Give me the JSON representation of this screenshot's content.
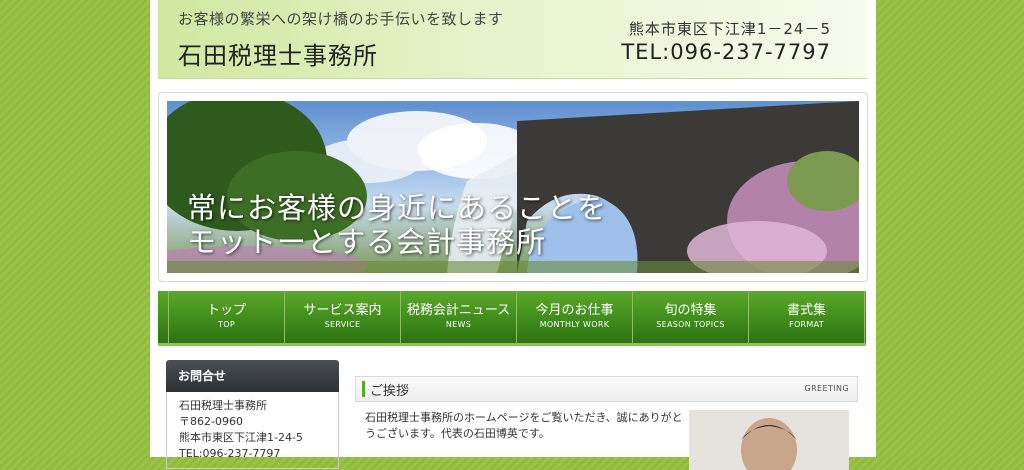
{
  "header": {
    "tagline": "お客様の繁栄への架け橋のお手伝いを致します",
    "firm_name": "石田税理士事務所",
    "address": "熊本市東区下江津1－24－5",
    "tel": "TEL:096-237-7797"
  },
  "hero": {
    "line1": "常にお客様の身近にあることを",
    "line2": "モットーとする会計事務所"
  },
  "nav": [
    {
      "jp": "トップ",
      "en": "TOP"
    },
    {
      "jp": "サービス案内",
      "en": "SERVICE"
    },
    {
      "jp": "税務会計ニュース",
      "en": "NEWS"
    },
    {
      "jp": "今月のお仕事",
      "en": "MONTHLY WORK"
    },
    {
      "jp": "旬の特集",
      "en": "SEASON TOPICS"
    },
    {
      "jp": "書式集",
      "en": "FORMAT"
    }
  ],
  "sidebar": {
    "title": "お問合せ",
    "firm": "石田税理士事務所",
    "postal": "〒862-0960",
    "address": "熊本市東区下江津1-24-5",
    "tel": "TEL:096-237-7797"
  },
  "main": {
    "section_title": "ご挨拶",
    "section_en": "GREETING",
    "text_line1": "石田税理士事務所のホームページをご覧いただき、誠にありがと",
    "text_line2": "うございます。代表の石田博英です。"
  },
  "colors": {
    "background": "#8fbb3e",
    "nav_green": "#3f8c1c",
    "sidebar_head": "#2d3136",
    "accent": "#5aa82a"
  }
}
